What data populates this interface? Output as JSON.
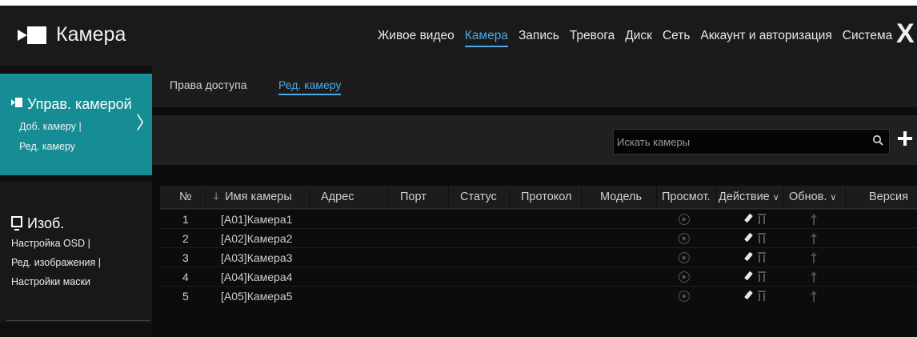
{
  "app": {
    "title": "Камера"
  },
  "topnav": {
    "items": [
      "Живое видео",
      "Камера",
      "Запись",
      "Тревога",
      "Диск",
      "Сеть",
      "Аккаунт и авторизация",
      "Система"
    ],
    "active": "Камера",
    "close": "X"
  },
  "sidebar": {
    "camera_group": {
      "title": "Управ. камерой",
      "items": [
        "Доб. камеру",
        "Ред. камеру"
      ]
    },
    "image_group": {
      "title": "Изоб.",
      "items": [
        "Настройка OSD",
        "Ред. изображения",
        "Настройки маски"
      ]
    },
    "separator": "|"
  },
  "tabs": [
    "Права доступа",
    "Ред. камеру"
  ],
  "search": {
    "placeholder": "Искать камеры"
  },
  "table": {
    "columns": [
      "№",
      "Имя камеры",
      "Адрес",
      "Порт",
      "Статус",
      "Протокол",
      "Модель",
      "Просмот.",
      "Действие",
      "Обнов.",
      "Версия"
    ],
    "rows": [
      {
        "no": "1",
        "name": "[A01]Камера1"
      },
      {
        "no": "2",
        "name": "[A02]Камера2"
      },
      {
        "no": "3",
        "name": "[A03]Камера3"
      },
      {
        "no": "4",
        "name": "[A04]Камера4"
      },
      {
        "no": "5",
        "name": "[A05]Камера5"
      }
    ]
  },
  "colors": {
    "accent": "#4aa9e6",
    "sidebar_active": "#168d94",
    "background": "#0c0c0c"
  },
  "icons": [
    "camera-icon",
    "close-icon",
    "chevron-right-icon",
    "monitor-icon",
    "search-icon",
    "add-icon",
    "sort-down-icon",
    "dropdown-icon",
    "play-icon",
    "edit-icon",
    "delete-icon",
    "upgrade-icon"
  ]
}
